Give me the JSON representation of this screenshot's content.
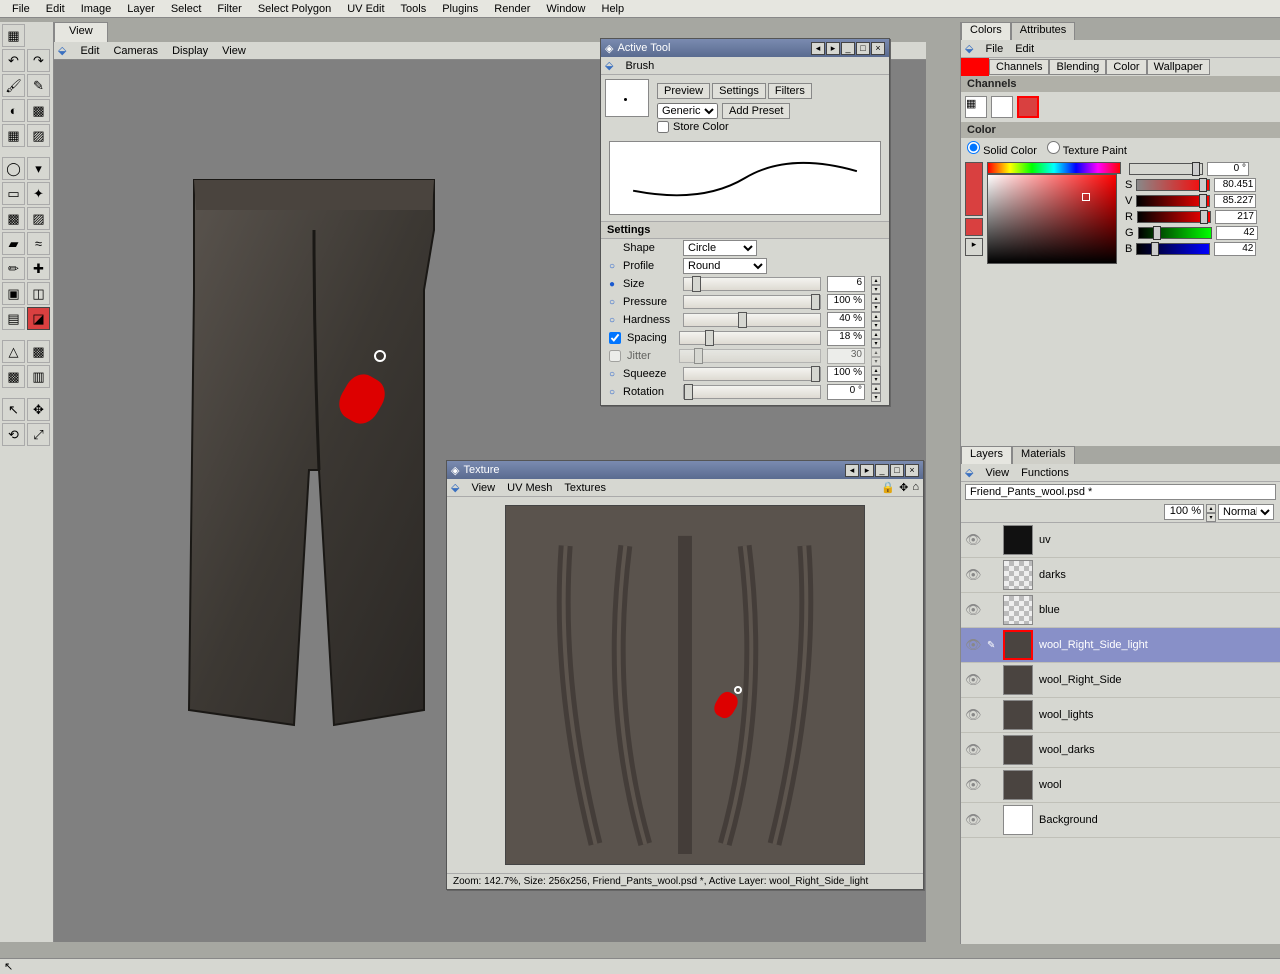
{
  "mainMenu": [
    "File",
    "Edit",
    "Image",
    "Layer",
    "Select",
    "Filter",
    "Select Polygon",
    "UV Edit",
    "Tools",
    "Plugins",
    "Render",
    "Window",
    "Help"
  ],
  "viewport": {
    "tab": "View",
    "menu": [
      "⬙",
      "Edit",
      "Cameras",
      "Display",
      "View"
    ]
  },
  "activeTool": {
    "title": "Active Tool",
    "sub": [
      "⬙",
      "Brush"
    ],
    "tabs": [
      "Preview",
      "Settings",
      "Filters"
    ],
    "presetSel": "Generic",
    "addPreset": "Add Preset",
    "storeColor": "Store Color",
    "settingsHead": "Settings",
    "shapeLabel": "Shape",
    "shapeSel": "Circle",
    "profileLabel": "Profile",
    "profileSel": "Round",
    "sizeLabel": "Size",
    "sizeVal": "6",
    "pressureLabel": "Pressure",
    "pressureVal": "100 %",
    "hardnessLabel": "Hardness",
    "hardnessVal": "40 %",
    "spacingLabel": "Spacing",
    "spacingVal": "18 %",
    "jitterLabel": "Jitter",
    "jitterVal": "30",
    "squeezeLabel": "Squeeze",
    "squeezeVal": "100 %",
    "rotationLabel": "Rotation",
    "rotationVal": "0 °"
  },
  "texture": {
    "title": "Texture",
    "sub": [
      "⬙",
      "View",
      "UV Mesh",
      "Textures"
    ],
    "status": "Zoom: 142.7%, Size: 256x256, Friend_Pants_wool.psd *, Active Layer: wool_Right_Side_light"
  },
  "colors": {
    "tabs": [
      "Colors",
      "Attributes"
    ],
    "sub": [
      "⬙",
      "File",
      "Edit"
    ],
    "stripTabs": [
      "Channels",
      "Blending",
      "Color",
      "Wallpaper"
    ],
    "channelsHead": "Channels",
    "colorHead": "Color",
    "solidLabel": "Solid Color",
    "texPaintLabel": "Texture Paint",
    "hVal": "0 °",
    "sVal": "80.451",
    "vVal": "85.227",
    "rVal": "217",
    "gVal": "42",
    "bVal": "42"
  },
  "layers": {
    "tabs": [
      "Layers",
      "Materials"
    ],
    "sub": [
      "⬙",
      "View",
      "Functions"
    ],
    "filename": "Friend_Pants_wool.psd *",
    "opacity": "100 %",
    "blend": "Normal",
    "items": [
      {
        "name": "uv",
        "thumb": "uvt"
      },
      {
        "name": "darks",
        "thumb": "checker"
      },
      {
        "name": "blue",
        "thumb": "checker"
      },
      {
        "name": "wool_Right_Side_light",
        "thumb": "dark",
        "sel": true
      },
      {
        "name": "wool_Right_Side",
        "thumb": "dark"
      },
      {
        "name": "wool_lights",
        "thumb": "dark"
      },
      {
        "name": "wool_darks",
        "thumb": "dark"
      },
      {
        "name": "wool",
        "thumb": "dark"
      },
      {
        "name": "Background",
        "thumb": "white"
      }
    ]
  }
}
